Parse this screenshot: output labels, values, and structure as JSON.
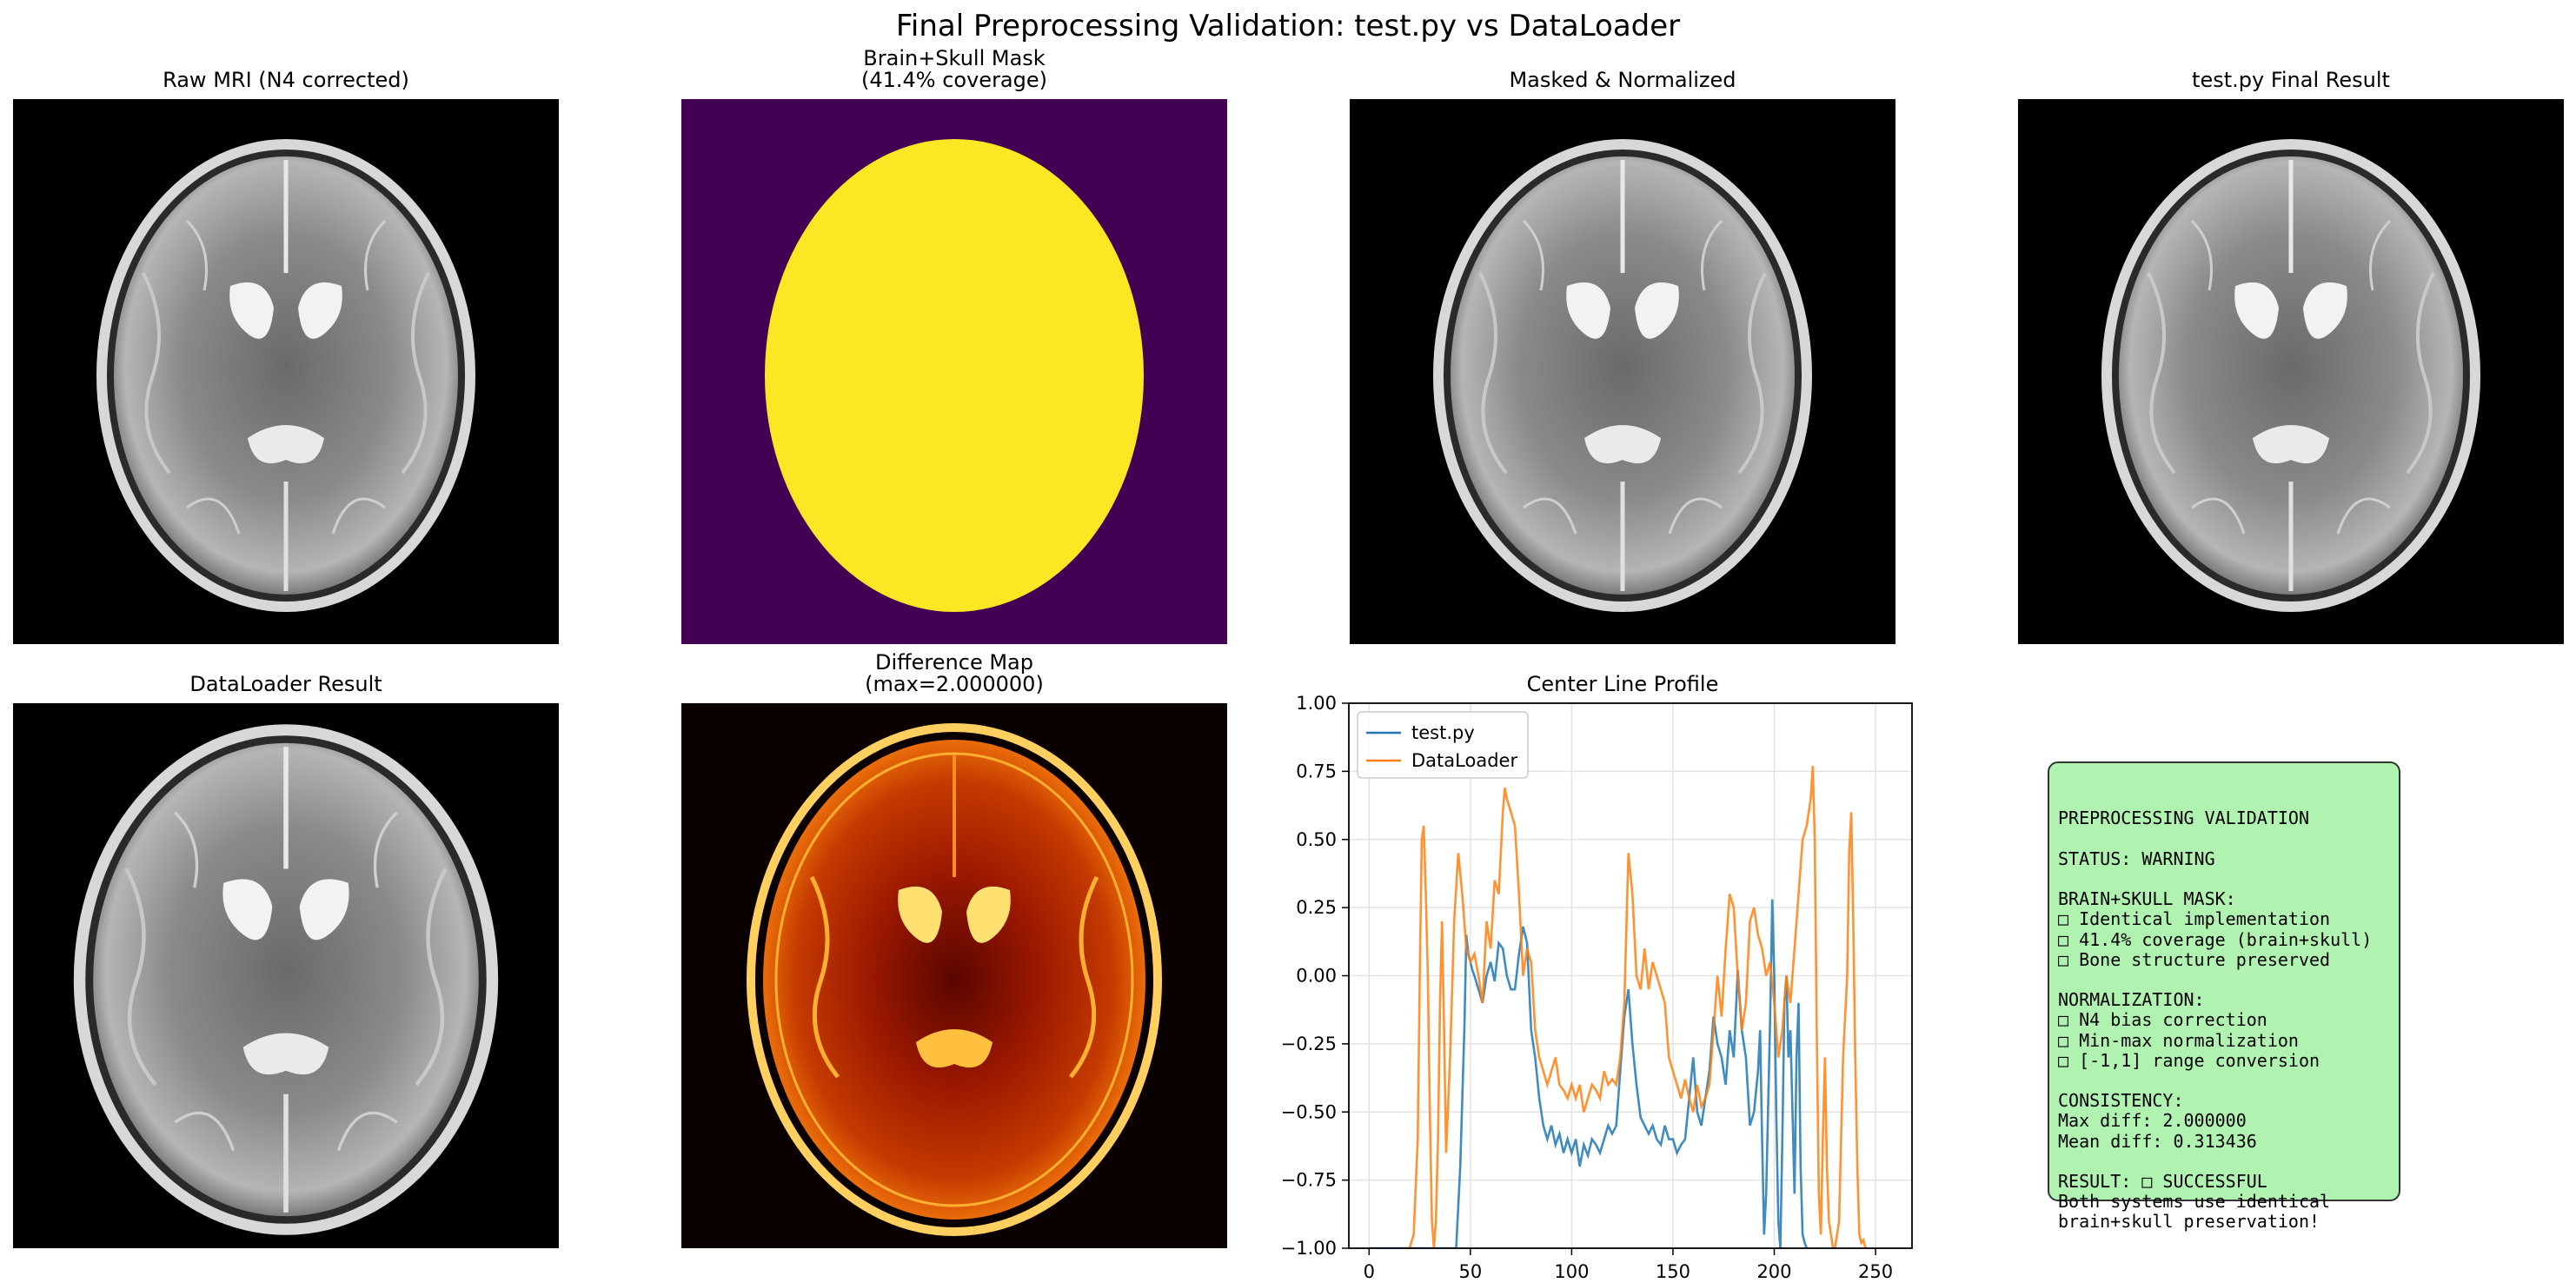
{
  "figure": {
    "suptitle": "Final Preprocessing Validation: test.py vs DataLoader"
  },
  "panels": {
    "raw": {
      "title": "Raw MRI (N4 corrected)"
    },
    "mask": {
      "title": "Brain+Skull Mask\n(41.4% coverage)"
    },
    "masked": {
      "title": "Masked & Normalized"
    },
    "testpy": {
      "title": "test.py Final Result"
    },
    "dataloader": {
      "title": "DataLoader Result"
    },
    "diff": {
      "title": "Difference Map\n(max=2.000000)"
    }
  },
  "colors": {
    "mask_background": "#440154",
    "mask_foreground": "#fde725",
    "testpy_line": "#1f77b4",
    "dataloader_line": "#ff7f0e",
    "textbox_fill": "#b0f2b0"
  },
  "chart_data": {
    "type": "line",
    "title": "Center Line Profile",
    "xlabel": "",
    "ylabel": "",
    "xlim": [
      -10,
      268
    ],
    "ylim": [
      -1.0,
      1.0
    ],
    "xticks": [
      0,
      50,
      100,
      150,
      200,
      250
    ],
    "yticks": [
      -1.0,
      -0.75,
      -0.5,
      -0.25,
      0.0,
      0.25,
      0.5,
      0.75,
      1.0
    ],
    "ytick_labels": [
      "−1.00",
      "−0.75",
      "−0.50",
      "−0.25",
      "0.00",
      "0.25",
      "0.50",
      "0.75",
      "1.00"
    ],
    "grid": true,
    "legend_position": "top-left",
    "series": [
      {
        "name": "test.py",
        "x": [
          0,
          10,
          20,
          30,
          40,
          43,
          45,
          47,
          48,
          49,
          50,
          51,
          52,
          54,
          56,
          58,
          60,
          62,
          64,
          66,
          68,
          70,
          72,
          74,
          76,
          78,
          80,
          82,
          84,
          86,
          88,
          90,
          92,
          94,
          96,
          98,
          100,
          102,
          104,
          106,
          108,
          110,
          112,
          114,
          116,
          118,
          120,
          122,
          124,
          126,
          128,
          130,
          132,
          134,
          136,
          138,
          140,
          142,
          144,
          146,
          148,
          150,
          152,
          154,
          156,
          158,
          160,
          162,
          164,
          166,
          168,
          170,
          172,
          174,
          176,
          178,
          180,
          182,
          184,
          186,
          188,
          190,
          192,
          193,
          194,
          195,
          196,
          198,
          199,
          200,
          201,
          202,
          203,
          204,
          205,
          206,
          207,
          208,
          209,
          210,
          211,
          212,
          213,
          214,
          215,
          216
        ],
        "values": [
          -1.0,
          -1.0,
          -1.0,
          -1.0,
          -1.0,
          -1.0,
          -0.7,
          -0.2,
          0.15,
          0.08,
          0.05,
          0.02,
          0.0,
          -0.05,
          -0.1,
          0.0,
          0.05,
          -0.02,
          0.12,
          0.1,
          0.0,
          -0.05,
          -0.05,
          0.08,
          0.18,
          0.12,
          -0.2,
          -0.3,
          -0.45,
          -0.55,
          -0.6,
          -0.55,
          -0.62,
          -0.58,
          -0.65,
          -0.6,
          -0.65,
          -0.6,
          -0.7,
          -0.62,
          -0.66,
          -0.6,
          -0.62,
          -0.65,
          -0.6,
          -0.55,
          -0.58,
          -0.55,
          -0.35,
          -0.15,
          -0.05,
          -0.25,
          -0.4,
          -0.52,
          -0.55,
          -0.58,
          -0.55,
          -0.6,
          -0.62,
          -0.55,
          -0.6,
          -0.6,
          -0.65,
          -0.62,
          -0.6,
          -0.45,
          -0.3,
          -0.5,
          -0.55,
          -0.45,
          -0.35,
          -0.15,
          -0.25,
          -0.3,
          -0.4,
          -0.2,
          -0.3,
          0.02,
          -0.2,
          -0.3,
          -0.55,
          -0.5,
          -0.35,
          -0.2,
          -0.6,
          -0.95,
          -0.8,
          -0.15,
          0.28,
          0.0,
          -0.5,
          -0.9,
          -1.0,
          -0.6,
          -0.1,
          0.0,
          -0.3,
          -0.2,
          -0.5,
          -0.8,
          -0.3,
          -0.1,
          -0.7,
          -0.95,
          -0.98,
          -1.0
        ]
      },
      {
        "name": "DataLoader",
        "x": [
          18,
          20,
          22,
          24,
          25,
          26,
          27,
          28,
          29,
          30,
          31,
          32,
          33,
          34,
          35,
          36,
          37,
          38,
          40,
          42,
          44,
          46,
          48,
          50,
          52,
          54,
          56,
          58,
          60,
          62,
          64,
          66,
          67,
          68,
          70,
          72,
          74,
          76,
          78,
          80,
          82,
          84,
          86,
          88,
          90,
          92,
          94,
          96,
          98,
          100,
          102,
          104,
          106,
          108,
          110,
          112,
          114,
          116,
          118,
          120,
          122,
          124,
          126,
          128,
          130,
          132,
          134,
          136,
          138,
          140,
          142,
          144,
          146,
          148,
          150,
          152,
          154,
          156,
          158,
          160,
          162,
          164,
          166,
          168,
          170,
          172,
          174,
          176,
          178,
          180,
          182,
          184,
          186,
          188,
          190,
          192,
          194,
          196,
          198,
          200,
          202,
          204,
          206,
          208,
          210,
          212,
          214,
          216,
          218,
          219,
          220,
          221,
          222,
          223,
          224,
          225,
          226,
          227,
          228,
          229,
          230,
          232,
          234,
          236,
          237,
          238,
          239,
          240,
          241,
          242,
          243,
          244,
          245,
          246
        ],
        "values": [
          -1.0,
          -1.0,
          -0.95,
          -0.6,
          0.0,
          0.5,
          0.55,
          0.3,
          0.0,
          -0.5,
          -0.9,
          -1.0,
          -0.9,
          -0.6,
          -0.1,
          0.2,
          -0.2,
          -0.65,
          -0.3,
          0.2,
          0.45,
          0.3,
          0.1,
          0.05,
          0.08,
          0.0,
          -0.1,
          0.2,
          0.1,
          0.35,
          0.3,
          0.6,
          0.69,
          0.65,
          0.6,
          0.55,
          0.3,
          0.0,
          0.1,
          0.05,
          -0.2,
          -0.3,
          -0.35,
          -0.4,
          -0.35,
          -0.3,
          -0.4,
          -0.42,
          -0.45,
          -0.4,
          -0.45,
          -0.4,
          -0.5,
          -0.45,
          -0.4,
          -0.42,
          -0.45,
          -0.35,
          -0.4,
          -0.38,
          -0.4,
          -0.3,
          -0.1,
          0.45,
          0.3,
          0.0,
          -0.05,
          0.1,
          -0.05,
          0.05,
          0.0,
          -0.05,
          -0.1,
          -0.3,
          -0.35,
          -0.4,
          -0.45,
          -0.38,
          -0.45,
          -0.5,
          -0.4,
          -0.48,
          -0.45,
          -0.4,
          -0.2,
          0.0,
          -0.15,
          0.1,
          0.3,
          0.25,
          0.0,
          -0.2,
          -0.1,
          0.2,
          0.25,
          0.15,
          0.1,
          0.0,
          0.05,
          -0.1,
          -0.3,
          -0.2,
          0.0,
          -0.1,
          0.1,
          0.3,
          0.5,
          0.55,
          0.65,
          0.77,
          0.5,
          -0.2,
          -0.8,
          -0.95,
          -0.6,
          -0.3,
          -0.7,
          -0.9,
          -0.95,
          -1.0,
          -1.0,
          -0.9,
          -0.3,
          0.0,
          0.45,
          0.6,
          0.2,
          -0.3,
          -0.7,
          -0.95,
          -0.98,
          -0.97,
          -1.0,
          -1.0
        ]
      }
    ]
  },
  "textbox": {
    "lines": [
      "PREPROCESSING VALIDATION",
      "",
      "STATUS: WARNING",
      "",
      "BRAIN+SKULL MASK:",
      "□ Identical implementation",
      "□ 41.4% coverage (brain+skull)",
      "□ Bone structure preserved",
      "",
      "NORMALIZATION:",
      "□ N4 bias correction",
      "□ Min-max normalization",
      "□ [-1,1] range conversion",
      "",
      "CONSISTENCY:",
      "Max diff: 2.000000",
      "Mean diff: 0.313436",
      "",
      "RESULT: □ SUCCESSFUL",
      "Both systems use identical",
      "brain+skull preservation!"
    ]
  }
}
